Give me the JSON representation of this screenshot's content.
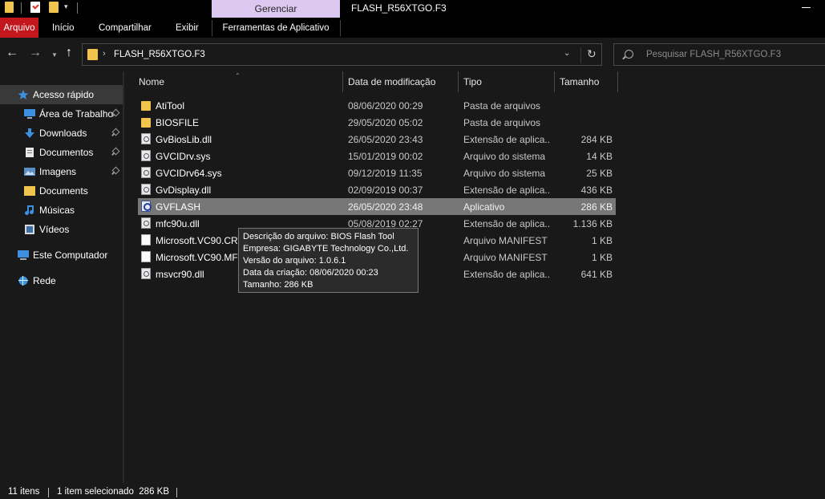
{
  "titlebar": {
    "manage_tab": "Gerenciar",
    "window_title": "FLASH_R56XTGO.F3"
  },
  "ribbon": {
    "file": "Arquivo",
    "home": "Início",
    "share": "Compartilhar",
    "view": "Exibir",
    "app_tools": "Ferramentas de Aplicativo"
  },
  "address": {
    "path": "FLASH_R56XTGO.F3",
    "search_placeholder": "Pesquisar FLASH_R56XTGO.F3"
  },
  "nav": {
    "items": [
      {
        "label": "Acesso rápido",
        "icon": "star-icon"
      },
      {
        "label": "Área de Trabalho",
        "icon": "desktop-icon"
      },
      {
        "label": "Downloads",
        "icon": "download-icon"
      },
      {
        "label": "Documentos",
        "icon": "documents-icon"
      },
      {
        "label": "Imagens",
        "icon": "pictures-icon"
      },
      {
        "label": "Documents",
        "icon": "folder-icon"
      },
      {
        "label": "Músicas",
        "icon": "music-icon"
      },
      {
        "label": "Vídeos",
        "icon": "videos-icon"
      },
      {
        "label": "Este Computador",
        "icon": "computer-icon"
      },
      {
        "label": "Rede",
        "icon": "network-icon"
      }
    ]
  },
  "columns": {
    "name": "Nome",
    "date": "Data de modificação",
    "type": "Tipo",
    "size": "Tamanho"
  },
  "files": [
    {
      "name": "AtiTool",
      "date": "08/06/2020 00:29",
      "type": "Pasta de arquivos",
      "size": "",
      "icon": "folder-icon"
    },
    {
      "name": "BIOSFILE",
      "date": "29/05/2020 05:02",
      "type": "Pasta de arquivos",
      "size": "",
      "icon": "folder-icon"
    },
    {
      "name": "GvBiosLib.dll",
      "date": "26/05/2020 23:43",
      "type": "Extensão de aplica...",
      "size": "284 KB",
      "icon": "dll-icon"
    },
    {
      "name": "GVCIDrv.sys",
      "date": "15/01/2019 00:02",
      "type": "Arquivo do sistema",
      "size": "14 KB",
      "icon": "sys-icon"
    },
    {
      "name": "GVCIDrv64.sys",
      "date": "09/12/2019 11:35",
      "type": "Arquivo do sistema",
      "size": "25 KB",
      "icon": "sys-icon"
    },
    {
      "name": "GvDisplay.dll",
      "date": "02/09/2019 00:37",
      "type": "Extensão de aplica...",
      "size": "436 KB",
      "icon": "dll-icon"
    },
    {
      "name": "GVFLASH",
      "date": "26/05/2020 23:48",
      "type": "Aplicativo",
      "size": "286 KB",
      "icon": "app-icon"
    },
    {
      "name": "mfc90u.dll",
      "date": "05/08/2019 02:27",
      "type": "Extensão de aplica...",
      "size": "1.136 KB",
      "icon": "dll-icon"
    },
    {
      "name": "Microsoft.VC90.CRT",
      "date": "",
      "type": "Arquivo MANIFEST",
      "size": "1 KB",
      "icon": "manifest-icon"
    },
    {
      "name": "Microsoft.VC90.MFC",
      "date": "",
      "type": "Arquivo MANIFEST",
      "size": "1 KB",
      "icon": "manifest-icon"
    },
    {
      "name": "msvcr90.dll",
      "date": "",
      "type": "Extensão de aplica...",
      "size": "641 KB",
      "icon": "dll-icon"
    }
  ],
  "tooltip": {
    "lines": [
      "Descrição do arquivo: BIOS Flash Tool",
      "Empresa: GIGABYTE Technology Co.,Ltd.",
      "Versão do arquivo: 1.0.6.1",
      "Data da criação: 08/06/2020 00:23",
      "Tamanho: 286 KB"
    ]
  },
  "status": {
    "count": "11 itens",
    "selected": "1 item selecionado  286 KB"
  }
}
